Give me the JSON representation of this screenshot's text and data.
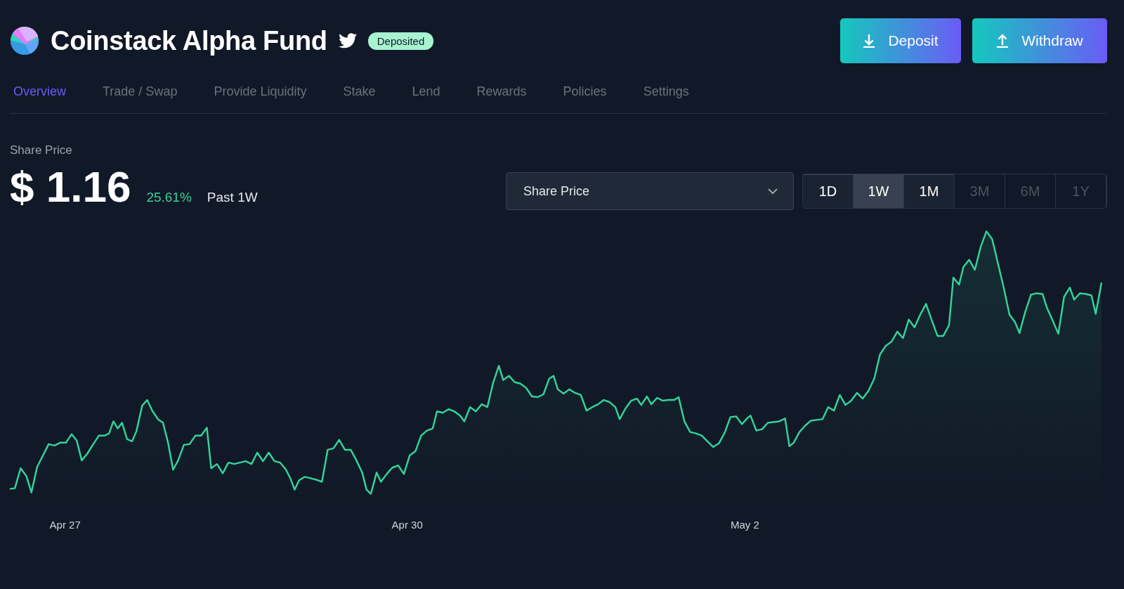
{
  "header": {
    "title": "Coinstack Alpha Fund",
    "badge": "Deposited",
    "buttons": [
      {
        "kind": "deposit",
        "label": "Deposit"
      },
      {
        "kind": "withdraw",
        "label": "Withdraw"
      }
    ]
  },
  "tabs": [
    {
      "label": "Overview",
      "selected": true
    },
    {
      "label": "Trade / Swap",
      "selected": false
    },
    {
      "label": "Provide Liquidity",
      "selected": false
    },
    {
      "label": "Stake",
      "selected": false
    },
    {
      "label": "Lend",
      "selected": false
    },
    {
      "label": "Rewards",
      "selected": false
    },
    {
      "label": "Policies",
      "selected": false
    },
    {
      "label": "Settings",
      "selected": false
    }
  ],
  "summary": {
    "label": "Share Price",
    "price": "$ 1.16",
    "change": "25.61%",
    "period": "Past 1W"
  },
  "metric_select": {
    "value": "Share Price"
  },
  "ranges": [
    {
      "label": "1D",
      "selected": false,
      "disabled": false
    },
    {
      "label": "1W",
      "selected": true,
      "disabled": false
    },
    {
      "label": "1M",
      "selected": false,
      "disabled": false
    },
    {
      "label": "3M",
      "selected": false,
      "disabled": true
    },
    {
      "label": "6M",
      "selected": false,
      "disabled": true
    },
    {
      "label": "1Y",
      "selected": false,
      "disabled": true
    }
  ],
  "chart": {
    "x_labels": [
      "Apr 27",
      "Apr 30",
      "May 2"
    ]
  }
}
